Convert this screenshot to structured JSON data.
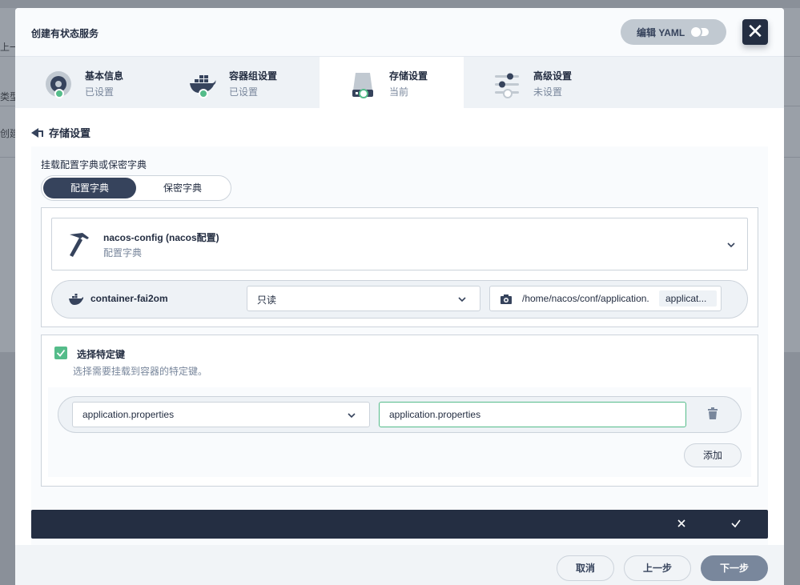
{
  "background": {
    "texts": [
      "上一",
      "类型",
      "创建"
    ]
  },
  "modal": {
    "title": "创建有状态服务",
    "yaml_label": "编辑 YAML",
    "close_symbol": "✕"
  },
  "steps": [
    {
      "title": "基本信息",
      "status": "已设置",
      "icon": "disc-icon",
      "state": "done"
    },
    {
      "title": "容器组设置",
      "status": "已设置",
      "icon": "docker-icon",
      "state": "done"
    },
    {
      "title": "存储设置",
      "status": "当前",
      "icon": "storage-icon",
      "state": "current"
    },
    {
      "title": "高级设置",
      "status": "未设置",
      "icon": "sliders-icon",
      "state": "pending"
    }
  ],
  "section": {
    "title": "存储设置",
    "mount_label": "挂载配置字典或保密字典",
    "tabs": [
      "配置字典",
      "保密字典"
    ],
    "active_tab": "配置字典"
  },
  "config": {
    "name": "nacos-config (nacos配置)",
    "type": "配置字典",
    "icon": "hammer-icon"
  },
  "container": {
    "name": "container-fai2om",
    "mode": "只读",
    "mount_path": "/home/nacos/conf/application.",
    "path_tag": "applicat..."
  },
  "specific_keys": {
    "checked": true,
    "label": "选择特定键",
    "description": "选择需要挂载到容器的特定键。",
    "rows": [
      {
        "key": "application.properties",
        "path": "application.properties"
      }
    ],
    "add_label": "添加"
  },
  "footer": {
    "cancel": "取消",
    "prev": "上一步",
    "next": "下一步"
  },
  "colors": {
    "primary_dark": "#242e42",
    "success": "#55bc8a",
    "muted": "#79879c",
    "border": "#ccd3db"
  }
}
